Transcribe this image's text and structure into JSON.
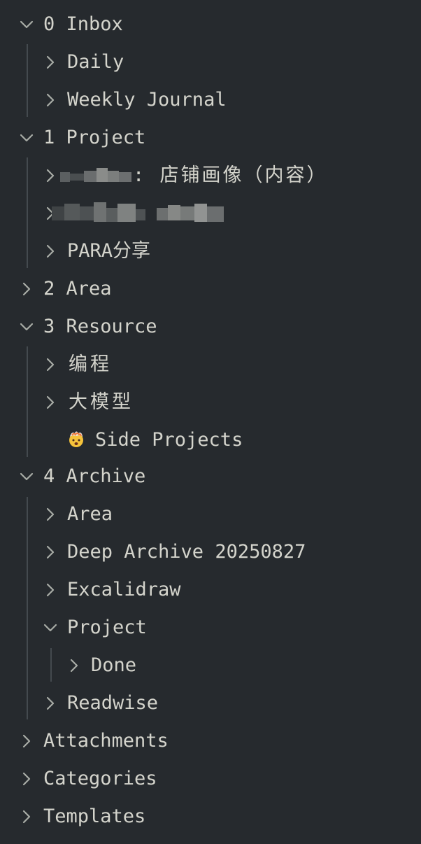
{
  "tree": {
    "inbox": {
      "label": "0 Inbox",
      "children": {
        "daily": "Daily",
        "weekly": "Weekly Journal"
      }
    },
    "project": {
      "label": "1 Project",
      "children": {
        "shop_suffix": ": 店铺画像（内容）",
        "para": "PARA分享"
      }
    },
    "area": {
      "label": "2 Area"
    },
    "resource": {
      "label": "3 Resource",
      "children": {
        "coding": "编程",
        "llm": "大模型",
        "side": "Side Projects",
        "side_icon": "exploding-head-emoji"
      }
    },
    "archive": {
      "label": "4 Archive",
      "children": {
        "area": "Area",
        "deep": "Deep Archive 20250827",
        "excalidraw": "Excalidraw",
        "project": "Project",
        "done": "Done",
        "readwise": "Readwise"
      }
    },
    "attachments": {
      "label": "Attachments"
    },
    "categories": {
      "label": "Categories"
    },
    "templates": {
      "label": "Templates"
    }
  },
  "colors": {
    "background": "#262a2e",
    "text": "#d4d4cc",
    "chevron": "#a8aca6",
    "guide": "#444a4f"
  }
}
